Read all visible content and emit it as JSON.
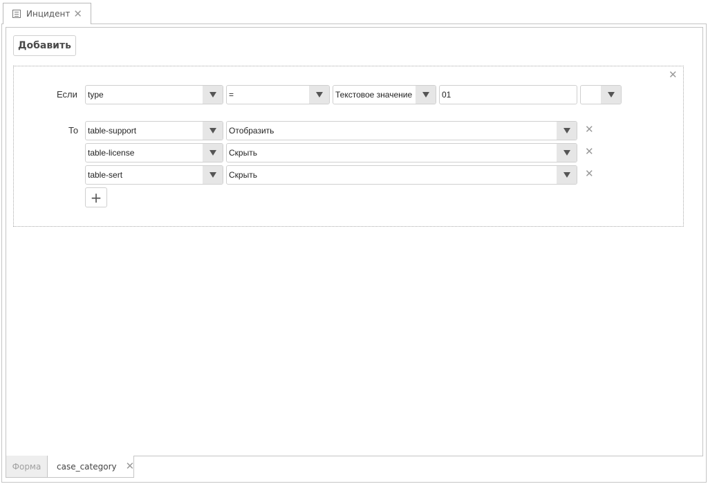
{
  "top_tab": {
    "label": "Инцидент",
    "icon": "document-icon"
  },
  "toolbar": {
    "add_label": "Добавить"
  },
  "rule": {
    "if_label": "Если",
    "then_label": "То",
    "condition": {
      "field": "type",
      "operator": "=",
      "value_type": "Текстовое значение",
      "value": "01",
      "extra": ""
    },
    "actions": [
      {
        "target": "table-support",
        "action": "Отобразить"
      },
      {
        "target": "table-license",
        "action": "Скрыть"
      },
      {
        "target": "table-sert",
        "action": "Скрыть"
      }
    ],
    "add_action_symbol": "+"
  },
  "bottom_tabs": [
    {
      "label": "Форма",
      "active": false
    },
    {
      "label": "case_category",
      "active": true
    }
  ],
  "icons": {
    "close": "close-icon",
    "dropdown": "chevron-down-icon",
    "add": "plus-icon"
  }
}
